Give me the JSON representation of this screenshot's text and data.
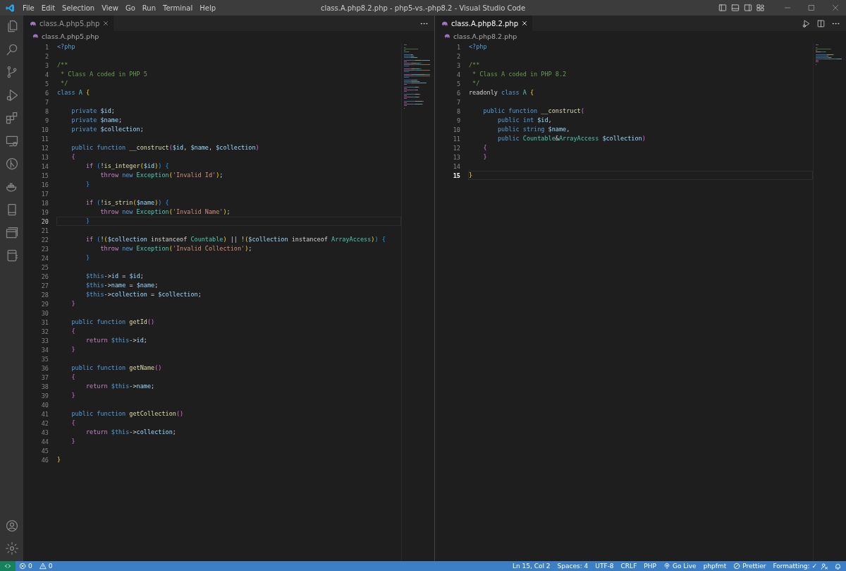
{
  "window": {
    "title": "class.A.php8.2.php - php5-vs.-php8.2 - Visual Studio Code"
  },
  "menu": [
    "File",
    "Edit",
    "Selection",
    "View",
    "Go",
    "Run",
    "Terminal",
    "Help"
  ],
  "groups": [
    {
      "focused": false,
      "tabs": [
        {
          "label": "class.A.php5.php",
          "selected": true
        }
      ],
      "breadcrumb": "class.A.php5.php",
      "lines": [
        {
          "number": "1",
          "current": false,
          "tokens": [
            {
              "kind": "kw",
              "text": "<?php"
            }
          ]
        },
        {
          "number": "2",
          "current": false
        },
        {
          "number": "3",
          "current": false,
          "tokens": [
            {
              "kind": "com",
              "text": "/**"
            }
          ]
        },
        {
          "number": "4",
          "current": false,
          "tokens": [
            {
              "kind": "com",
              "text": " * Class A coded in PHP 5"
            }
          ]
        },
        {
          "number": "5",
          "current": false,
          "tokens": [
            {
              "kind": "com",
              "text": " */"
            }
          ]
        },
        {
          "number": "6",
          "current": false,
          "tokens": [
            {
              "kind": "kw",
              "text": "class "
            },
            {
              "kind": "type",
              "text": "A "
            },
            {
              "kind": "br1",
              "text": "{"
            }
          ]
        },
        {
          "number": "7",
          "current": false
        },
        {
          "number": "8",
          "current": false,
          "tokens": [
            {
              "kind": "kw",
              "text": "    private "
            },
            {
              "kind": "var",
              "text": "$id"
            },
            {
              "kind": "plain",
              "text": ";"
            }
          ]
        },
        {
          "number": "9",
          "current": false,
          "tokens": [
            {
              "kind": "kw",
              "text": "    private "
            },
            {
              "kind": "var",
              "text": "$name"
            },
            {
              "kind": "plain",
              "text": ";"
            }
          ]
        },
        {
          "number": "10",
          "current": false,
          "tokens": [
            {
              "kind": "kw",
              "text": "    private "
            },
            {
              "kind": "var",
              "text": "$collection"
            },
            {
              "kind": "plain",
              "text": ";"
            }
          ]
        },
        {
          "number": "11",
          "current": false
        },
        {
          "number": "12",
          "current": false,
          "tokens": [
            {
              "kind": "kw",
              "text": "    public function "
            },
            {
              "kind": "fn",
              "text": "__construct"
            },
            {
              "kind": "br2",
              "text": "("
            },
            {
              "kind": "var",
              "text": "$id"
            },
            {
              "kind": "plain",
              "text": ", "
            },
            {
              "kind": "var",
              "text": "$name"
            },
            {
              "kind": "plain",
              "text": ", "
            },
            {
              "kind": "var",
              "text": "$collection"
            },
            {
              "kind": "br2",
              "text": ")"
            }
          ]
        },
        {
          "number": "13",
          "current": false,
          "tokens": [
            {
              "kind": "br2",
              "text": "    {"
            }
          ]
        },
        {
          "number": "14",
          "current": false,
          "tokens": [
            {
              "kind": "ctl",
              "text": "        if "
            },
            {
              "kind": "br3",
              "text": "("
            },
            {
              "kind": "plain",
              "text": "!"
            },
            {
              "kind": "fn",
              "text": "is_integer"
            },
            {
              "kind": "br1",
              "text": "("
            },
            {
              "kind": "var",
              "text": "$id"
            },
            {
              "kind": "br1",
              "text": ")"
            },
            {
              "kind": "br3",
              "text": ") {"
            }
          ]
        },
        {
          "number": "15",
          "current": false,
          "tokens": [
            {
              "kind": "ctl",
              "text": "            throw "
            },
            {
              "kind": "kw",
              "text": "new "
            },
            {
              "kind": "type",
              "text": "Exception"
            },
            {
              "kind": "br1",
              "text": "("
            },
            {
              "kind": "str",
              "text": "'Invalid Id'"
            },
            {
              "kind": "br1",
              "text": ")"
            },
            {
              "kind": "plain",
              "text": ";"
            }
          ]
        },
        {
          "number": "16",
          "current": false,
          "tokens": [
            {
              "kind": "br3",
              "text": "        }"
            }
          ]
        },
        {
          "number": "17",
          "current": false
        },
        {
          "number": "18",
          "current": false,
          "tokens": [
            {
              "kind": "ctl",
              "text": "        if "
            },
            {
              "kind": "br3",
              "text": "("
            },
            {
              "kind": "plain",
              "text": "!"
            },
            {
              "kind": "fn",
              "text": "is_strin"
            },
            {
              "kind": "br1",
              "text": "("
            },
            {
              "kind": "var",
              "text": "$name"
            },
            {
              "kind": "br1",
              "text": ")"
            },
            {
              "kind": "br3",
              "text": ") {"
            }
          ]
        },
        {
          "number": "19",
          "current": false,
          "tokens": [
            {
              "kind": "ctl",
              "text": "            throw "
            },
            {
              "kind": "kw",
              "text": "new "
            },
            {
              "kind": "type",
              "text": "Exception"
            },
            {
              "kind": "br1",
              "text": "("
            },
            {
              "kind": "str",
              "text": "'Invalid Name'"
            },
            {
              "kind": "br1",
              "text": ")"
            },
            {
              "kind": "plain",
              "text": ";"
            }
          ]
        },
        {
          "number": "20",
          "current": true,
          "tokens": [
            {
              "kind": "br3",
              "text": "        }"
            }
          ]
        },
        {
          "number": "21",
          "current": false
        },
        {
          "number": "22",
          "current": false,
          "tokens": [
            {
              "kind": "ctl",
              "text": "        if "
            },
            {
              "kind": "br3",
              "text": "("
            },
            {
              "kind": "plain",
              "text": "!"
            },
            {
              "kind": "br1",
              "text": "("
            },
            {
              "kind": "var",
              "text": "$collection"
            },
            {
              "kind": "plain",
              "text": " instanceof "
            },
            {
              "kind": "type",
              "text": "Countable"
            },
            {
              "kind": "br1",
              "text": ")"
            },
            {
              "kind": "plain",
              "text": " || !"
            },
            {
              "kind": "br1",
              "text": "("
            },
            {
              "kind": "var",
              "text": "$collection"
            },
            {
              "kind": "plain",
              "text": " instanceof "
            },
            {
              "kind": "type",
              "text": "ArrayAccess"
            },
            {
              "kind": "br1",
              "text": ")"
            },
            {
              "kind": "br3",
              "text": ") {"
            }
          ]
        },
        {
          "number": "23",
          "current": false,
          "tokens": [
            {
              "kind": "ctl",
              "text": "            throw "
            },
            {
              "kind": "kw",
              "text": "new "
            },
            {
              "kind": "type",
              "text": "Exception"
            },
            {
              "kind": "br1",
              "text": "("
            },
            {
              "kind": "str",
              "text": "'Invalid Collection'"
            },
            {
              "kind": "br1",
              "text": ")"
            },
            {
              "kind": "plain",
              "text": ";"
            }
          ]
        },
        {
          "number": "24",
          "current": false,
          "tokens": [
            {
              "kind": "br3",
              "text": "        }"
            }
          ]
        },
        {
          "number": "25",
          "current": false
        },
        {
          "number": "26",
          "current": false,
          "tokens": [
            {
              "kind": "kw",
              "text": "        $this"
            },
            {
              "kind": "plain",
              "text": "->"
            },
            {
              "kind": "var",
              "text": "id"
            },
            {
              "kind": "plain",
              "text": " = "
            },
            {
              "kind": "var",
              "text": "$id"
            },
            {
              "kind": "plain",
              "text": ";"
            }
          ]
        },
        {
          "number": "27",
          "current": false,
          "tokens": [
            {
              "kind": "kw",
              "text": "        $this"
            },
            {
              "kind": "plain",
              "text": "->"
            },
            {
              "kind": "var",
              "text": "name"
            },
            {
              "kind": "plain",
              "text": " = "
            },
            {
              "kind": "var",
              "text": "$name"
            },
            {
              "kind": "plain",
              "text": ";"
            }
          ]
        },
        {
          "number": "28",
          "current": false,
          "tokens": [
            {
              "kind": "kw",
              "text": "        $this"
            },
            {
              "kind": "plain",
              "text": "->"
            },
            {
              "kind": "var",
              "text": "collection"
            },
            {
              "kind": "plain",
              "text": " = "
            },
            {
              "kind": "var",
              "text": "$collection"
            },
            {
              "kind": "plain",
              "text": ";"
            }
          ]
        },
        {
          "number": "29",
          "current": false,
          "tokens": [
            {
              "kind": "br2",
              "text": "    }"
            }
          ]
        },
        {
          "number": "30",
          "current": false
        },
        {
          "number": "31",
          "current": false,
          "tokens": [
            {
              "kind": "kw",
              "text": "    public function "
            },
            {
              "kind": "fn",
              "text": "getId"
            },
            {
              "kind": "br2",
              "text": "()"
            }
          ]
        },
        {
          "number": "32",
          "current": false,
          "tokens": [
            {
              "kind": "br2",
              "text": "    {"
            }
          ]
        },
        {
          "number": "33",
          "current": false,
          "tokens": [
            {
              "kind": "ctl",
              "text": "        return "
            },
            {
              "kind": "kw",
              "text": "$this"
            },
            {
              "kind": "plain",
              "text": "->"
            },
            {
              "kind": "var",
              "text": "id"
            },
            {
              "kind": "plain",
              "text": ";"
            }
          ]
        },
        {
          "number": "34",
          "current": false,
          "tokens": [
            {
              "kind": "br2",
              "text": "    }"
            }
          ]
        },
        {
          "number": "35",
          "current": false
        },
        {
          "number": "36",
          "current": false,
          "tokens": [
            {
              "kind": "kw",
              "text": "    public function "
            },
            {
              "kind": "fn",
              "text": "getName"
            },
            {
              "kind": "br2",
              "text": "()"
            }
          ]
        },
        {
          "number": "37",
          "current": false,
          "tokens": [
            {
              "kind": "br2",
              "text": "    {"
            }
          ]
        },
        {
          "number": "38",
          "current": false,
          "tokens": [
            {
              "kind": "ctl",
              "text": "        return "
            },
            {
              "kind": "kw",
              "text": "$this"
            },
            {
              "kind": "plain",
              "text": "->"
            },
            {
              "kind": "var",
              "text": "name"
            },
            {
              "kind": "plain",
              "text": ";"
            }
          ]
        },
        {
          "number": "39",
          "current": false,
          "tokens": [
            {
              "kind": "br2",
              "text": "    }"
            }
          ]
        },
        {
          "number": "40",
          "current": false
        },
        {
          "number": "41",
          "current": false,
          "tokens": [
            {
              "kind": "kw",
              "text": "    public function "
            },
            {
              "kind": "fn",
              "text": "getCollection"
            },
            {
              "kind": "br2",
              "text": "()"
            }
          ]
        },
        {
          "number": "42",
          "current": false,
          "tokens": [
            {
              "kind": "br2",
              "text": "    {"
            }
          ]
        },
        {
          "number": "43",
          "current": false,
          "tokens": [
            {
              "kind": "ctl",
              "text": "        return "
            },
            {
              "kind": "kw",
              "text": "$this"
            },
            {
              "kind": "plain",
              "text": "->"
            },
            {
              "kind": "var",
              "text": "collection"
            },
            {
              "kind": "plain",
              "text": ";"
            }
          ]
        },
        {
          "number": "44",
          "current": false,
          "tokens": [
            {
              "kind": "br2",
              "text": "    }"
            }
          ]
        },
        {
          "number": "45",
          "current": false
        },
        {
          "number": "46",
          "current": false,
          "tokens": [
            {
              "kind": "br1",
              "text": "}"
            }
          ]
        }
      ]
    },
    {
      "focused": true,
      "tabs": [
        {
          "label": "class.A.php8.2.php",
          "selected": true
        }
      ],
      "breadcrumb": "class.A.php8.2.php",
      "lines": [
        {
          "number": "1",
          "current": false,
          "tokens": [
            {
              "kind": "kw",
              "text": "<?php"
            }
          ]
        },
        {
          "number": "2",
          "current": false
        },
        {
          "number": "3",
          "current": false,
          "tokens": [
            {
              "kind": "com",
              "text": "/**"
            }
          ]
        },
        {
          "number": "4",
          "current": false,
          "tokens": [
            {
              "kind": "com",
              "text": " * Class A coded in PHP 8.2"
            }
          ]
        },
        {
          "number": "5",
          "current": false,
          "tokens": [
            {
              "kind": "com",
              "text": " */"
            }
          ]
        },
        {
          "number": "6",
          "current": false,
          "tokens": [
            {
              "kind": "plain",
              "text": "readonly "
            },
            {
              "kind": "kw",
              "text": "class "
            },
            {
              "kind": "type",
              "text": "A "
            },
            {
              "kind": "br1",
              "text": "{"
            }
          ]
        },
        {
          "number": "7",
          "current": false
        },
        {
          "number": "8",
          "current": false,
          "tokens": [
            {
              "kind": "kw",
              "text": "    public function "
            },
            {
              "kind": "fn",
              "text": "__construct"
            },
            {
              "kind": "br2",
              "text": "("
            }
          ]
        },
        {
          "number": "9",
          "current": false,
          "tokens": [
            {
              "kind": "kw",
              "text": "        public int "
            },
            {
              "kind": "var",
              "text": "$id"
            },
            {
              "kind": "plain",
              "text": ","
            }
          ]
        },
        {
          "number": "10",
          "current": false,
          "tokens": [
            {
              "kind": "kw",
              "text": "        public string "
            },
            {
              "kind": "var",
              "text": "$name"
            },
            {
              "kind": "plain",
              "text": ","
            }
          ]
        },
        {
          "number": "11",
          "current": false,
          "tokens": [
            {
              "kind": "kw",
              "text": "        public "
            },
            {
              "kind": "type",
              "text": "Countable"
            },
            {
              "kind": "plain",
              "text": "&"
            },
            {
              "kind": "type",
              "text": "ArrayAccess "
            },
            {
              "kind": "var",
              "text": "$collection"
            },
            {
              "kind": "br2",
              "text": ")"
            }
          ]
        },
        {
          "number": "12",
          "current": false,
          "tokens": [
            {
              "kind": "br2",
              "text": "    {"
            }
          ]
        },
        {
          "number": "13",
          "current": false,
          "tokens": [
            {
              "kind": "br2",
              "text": "    }"
            }
          ]
        },
        {
          "number": "14",
          "current": false
        },
        {
          "number": "15",
          "current": true,
          "tokens": [
            {
              "kind": "br1",
              "text": "}"
            }
          ]
        }
      ]
    }
  ],
  "status_bar": {
    "left": [
      {
        "kind": "errors",
        "text": "0"
      },
      {
        "kind": "warnings",
        "text": "0"
      }
    ],
    "right": [
      {
        "kind": "plain",
        "text": "Ln 15, Col 2"
      },
      {
        "kind": "plain",
        "text": "Spaces: 4"
      },
      {
        "kind": "plain",
        "text": "UTF-8"
      },
      {
        "kind": "plain",
        "text": "CRLF"
      },
      {
        "kind": "plain",
        "text": "PHP"
      },
      {
        "kind": "live",
        "text": "Go Live"
      },
      {
        "kind": "plain",
        "text": "phpfmt"
      },
      {
        "kind": "prettier",
        "text": "Prettier"
      },
      {
        "kind": "plain",
        "text": "Formatting: ✓"
      }
    ]
  }
}
